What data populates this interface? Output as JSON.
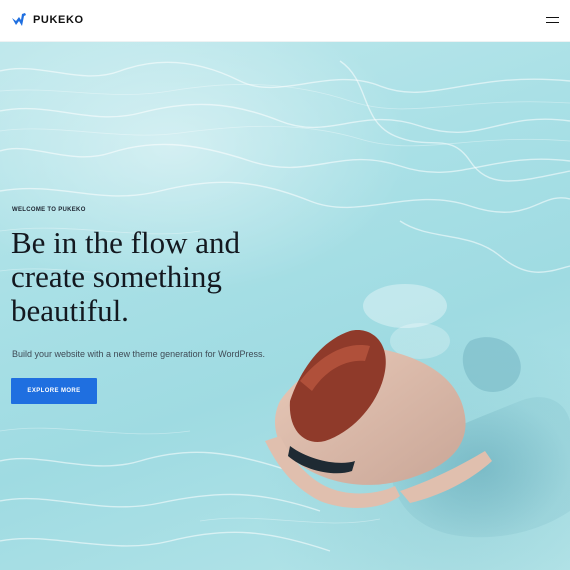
{
  "header": {
    "brand": "PUKEKO",
    "brand_color": "#1f6fe0",
    "logo_icon": "pukeko-bird-logo",
    "menu_icon": "hamburger-menu-icon"
  },
  "hero": {
    "eyebrow": "WELCOME TO PUKEKO",
    "headline_lines": [
      "Be in the flow and",
      "create something",
      "beautiful."
    ],
    "subtitle": "Build your website with a new theme generation for WordPress.",
    "cta_label": "EXPLORE MORE",
    "cta_color": "#1f6fe0",
    "background_image": "woman swimming underwater in clear turquoise pool"
  }
}
